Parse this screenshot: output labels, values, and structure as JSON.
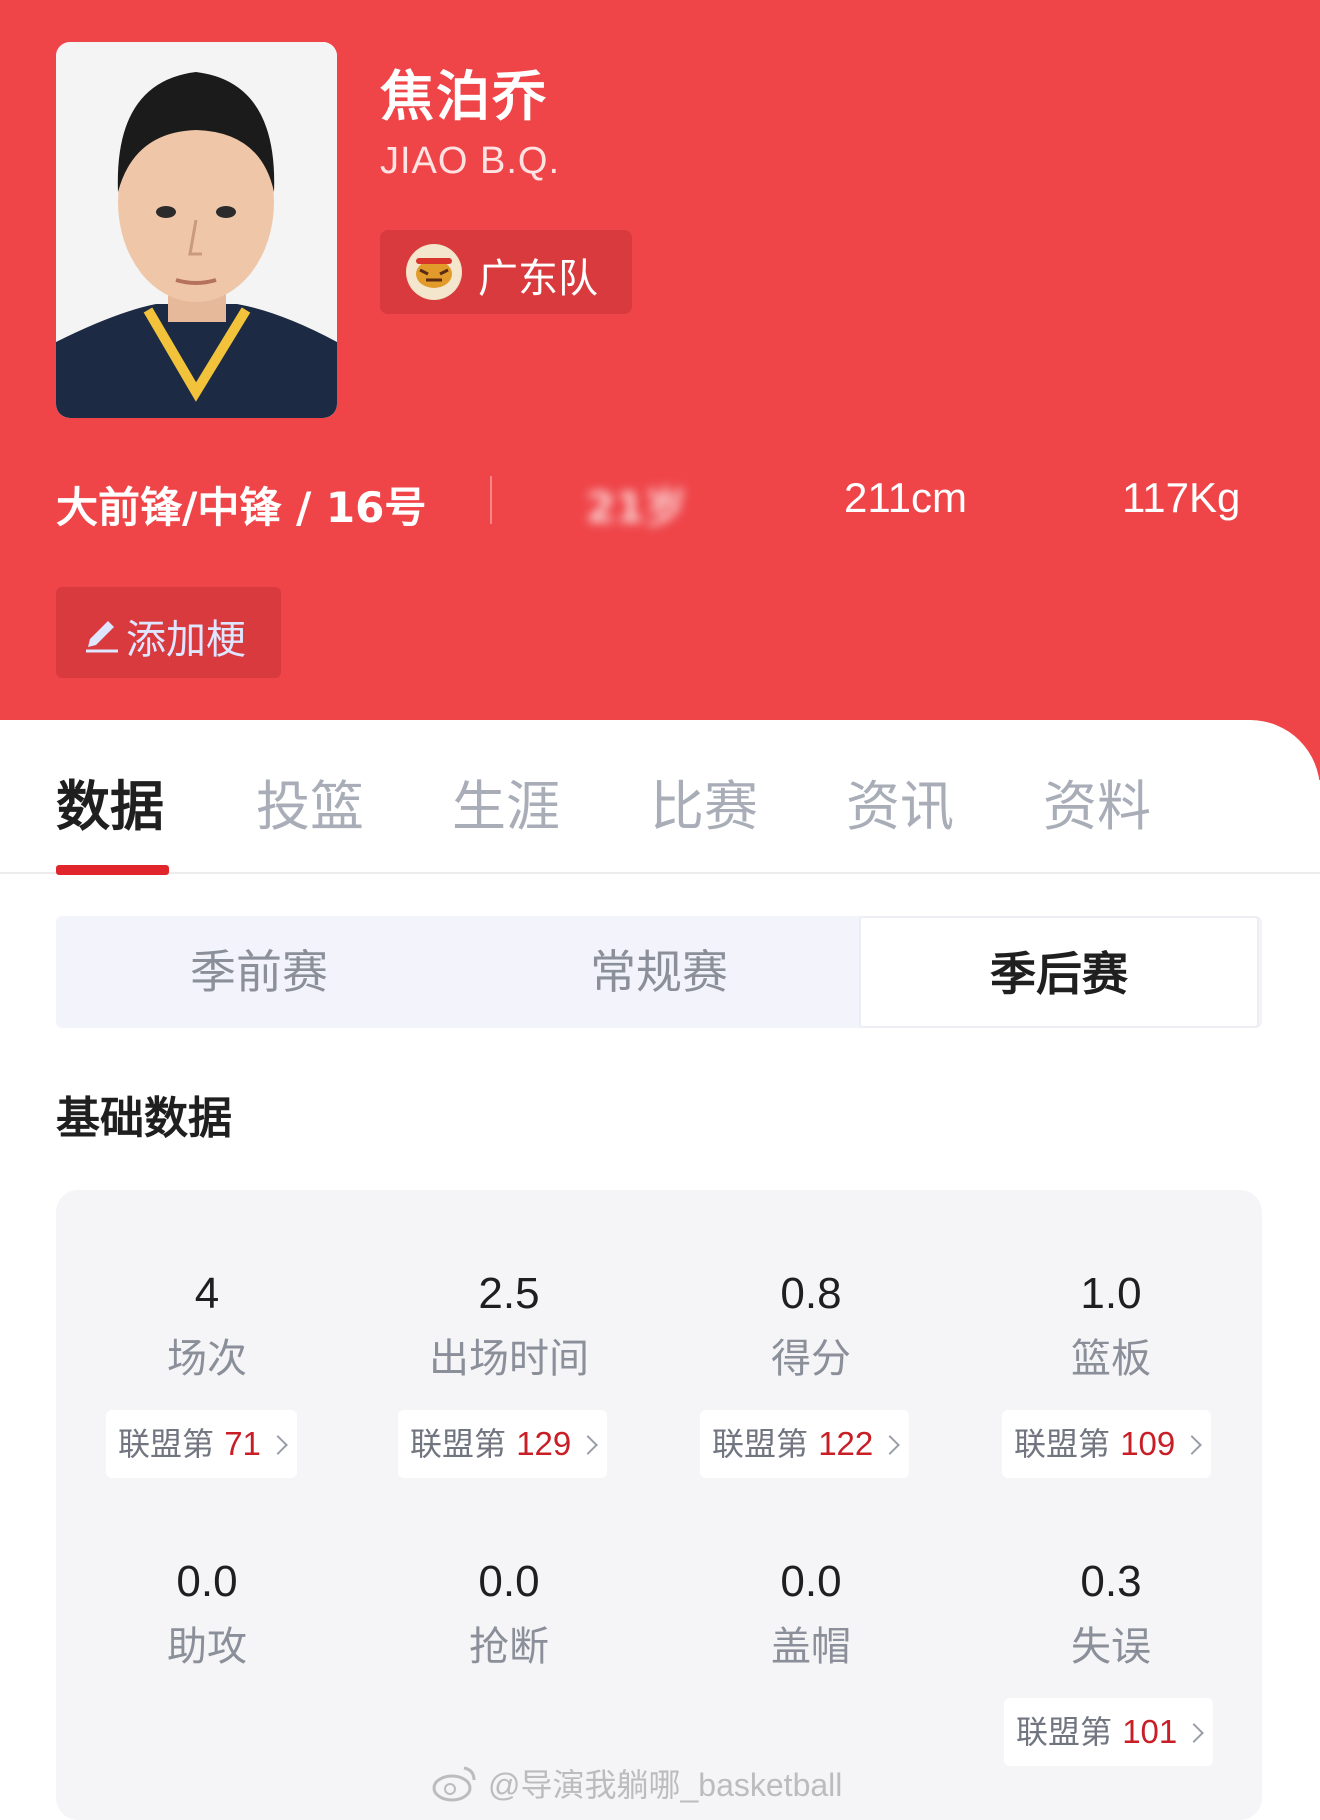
{
  "player": {
    "name_cn": "焦泊乔",
    "name_en": "JIAO B.Q.",
    "team": "广东队",
    "position_number": "大前锋/中锋 / 16号",
    "age_blurred": "21岁",
    "height": "211cm",
    "weight": "117Kg",
    "add_tag_label": "添加梗"
  },
  "tabs": [
    {
      "label": "数据",
      "active": true
    },
    {
      "label": "投篮",
      "active": false
    },
    {
      "label": "生涯",
      "active": false
    },
    {
      "label": "比赛",
      "active": false
    },
    {
      "label": "资讯",
      "active": false
    },
    {
      "label": "资料",
      "active": false
    }
  ],
  "season_types": [
    {
      "label": "季前赛",
      "active": false
    },
    {
      "label": "常规赛",
      "active": false
    },
    {
      "label": "季后赛",
      "active": true
    }
  ],
  "section_title": "基础数据",
  "stats": [
    {
      "value": "4",
      "label": "场次",
      "rank_prefix": "联盟第",
      "rank": "71"
    },
    {
      "value": "2.5",
      "label": "出场时间",
      "rank_prefix": "联盟第",
      "rank": "129"
    },
    {
      "value": "0.8",
      "label": "得分",
      "rank_prefix": "联盟第",
      "rank": "122"
    },
    {
      "value": "1.0",
      "label": "篮板",
      "rank_prefix": "联盟第",
      "rank": "109"
    },
    {
      "value": "0.0",
      "label": "助攻"
    },
    {
      "value": "0.0",
      "label": "抢断"
    },
    {
      "value": "0.0",
      "label": "盖帽"
    },
    {
      "value": "0.3",
      "label": "失误",
      "rank_prefix": "联盟第",
      "rank": "101"
    }
  ],
  "watermark": "@导演我躺哪_basketball",
  "colors": {
    "header_bg": "#ef4549",
    "accent_red": "#e0262c",
    "rank_red": "#c81e26"
  },
  "icons": [
    "pen-icon",
    "chevron-right-icon",
    "team-logo",
    "weibo-icon"
  ]
}
